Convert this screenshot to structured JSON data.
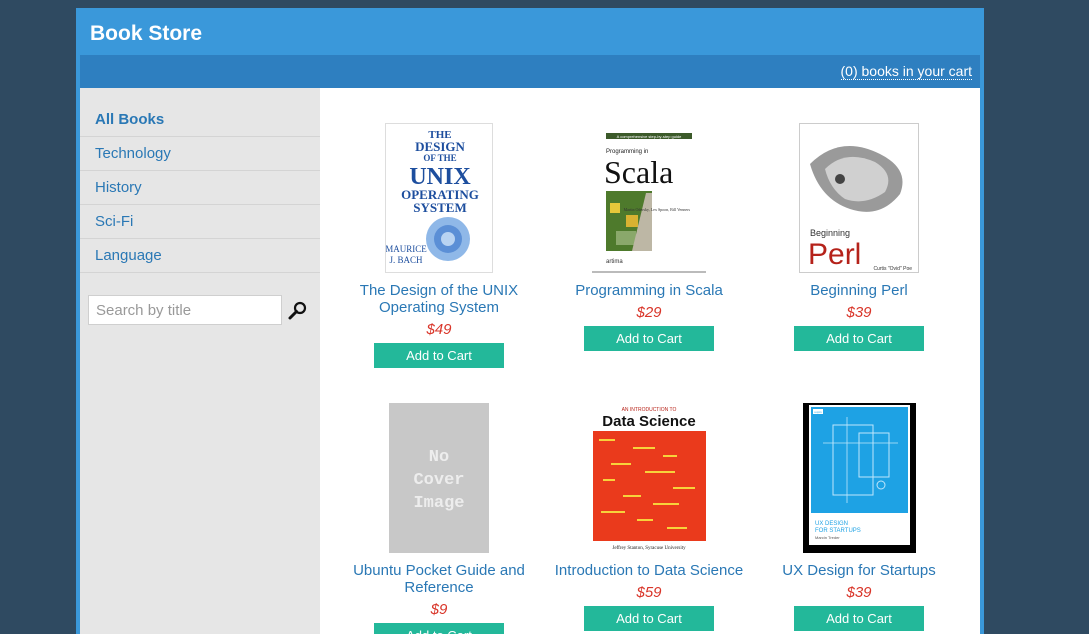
{
  "header": {
    "title": "Book Store"
  },
  "cart": {
    "label": "(0) books in your cart"
  },
  "sidebar": {
    "categories": [
      {
        "label": "All Books"
      },
      {
        "label": "Technology"
      },
      {
        "label": "History"
      },
      {
        "label": "Sci-Fi"
      },
      {
        "label": "Language"
      }
    ]
  },
  "search": {
    "placeholder": "Search by title",
    "icon": "search-icon"
  },
  "books": [
    {
      "title": "The Design of the UNIX Operating System",
      "price": "$49",
      "button": "Add to Cart",
      "cover_text": {
        "line1": "THE",
        "line2": "DESIGN",
        "line3": "OF THE",
        "line4": "UNIX",
        "line5": "OPERATING",
        "line6": "SYSTEM",
        "author1": "MAURICE",
        "author2": "J. BACH"
      }
    },
    {
      "title": "Programming in Scala",
      "price": "$29",
      "button": "Add to Cart",
      "cover_text": {
        "tagline": "A comprehensive step-by-step guide",
        "small": "Programming in",
        "big": "Scala",
        "authors": "Martin Odersky, Lex Spoon, Bill Venners",
        "publisher": "artima"
      }
    },
    {
      "title": "Beginning Perl",
      "price": "$39",
      "button": "Add to Cart",
      "cover_text": {
        "small": "Beginning",
        "big": "Perl",
        "author": "Curtis \"Ovid\" Poe"
      }
    },
    {
      "title": "Ubuntu Pocket Guide and Reference",
      "price": "$9",
      "button": "Add to Cart",
      "cover_text": {
        "line1": "No",
        "line2": "Cover",
        "line3": "Image"
      }
    },
    {
      "title": "Introduction to Data Science",
      "price": "$59",
      "button": "Add to Cart",
      "cover_text": {
        "small": "AN INTRODUCTION TO",
        "big": "Data Science",
        "author": "Jeffrey Stanton, Syracuse University"
      }
    },
    {
      "title": "UX Design for Startups",
      "price": "$39",
      "button": "Add to Cart",
      "cover_text": {
        "line1": "UX DESIGN",
        "line2": "FOR STARTUPS",
        "author": "Marcin Treder",
        "badge": "uxpin"
      }
    }
  ],
  "colors": {
    "accent": "#3a98da",
    "link": "#2a78b5",
    "price": "#d9362a",
    "button": "#23b89a"
  }
}
